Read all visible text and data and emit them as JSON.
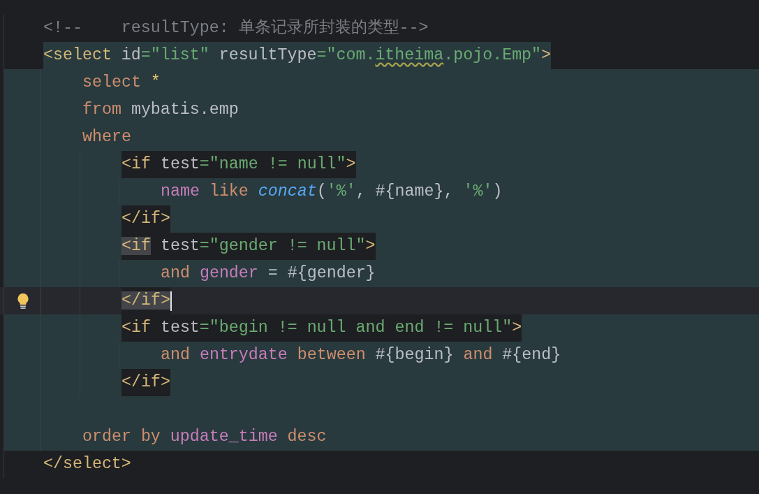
{
  "editor": {
    "lines": [
      {
        "highlighted": false,
        "current": false,
        "tokens": [
          {
            "kind": "comment",
            "text": "<!--    resultType: 单条记录所封装的类型-->"
          }
        ]
      },
      {
        "highlighted": false,
        "boxed": true,
        "current": false,
        "tokens": [
          {
            "kind": "tag",
            "text": "<select"
          },
          {
            "kind": "attr",
            "text": " id"
          },
          {
            "kind": "string",
            "text": "=\"list\""
          },
          {
            "kind": "attr",
            "text": " resultType"
          },
          {
            "kind": "string",
            "text": "=\"com."
          },
          {
            "kind": "string",
            "text": "itheima",
            "warning": true
          },
          {
            "kind": "string",
            "text": ".pojo.Emp\""
          },
          {
            "kind": "tag",
            "text": ">"
          }
        ],
        "children": [
          {
            "highlighted": true,
            "current": false,
            "tokens": [
              {
                "kind": "keyword",
                "text": "select"
              },
              {
                "kind": "operator",
                "text": " *"
              }
            ]
          },
          {
            "highlighted": true,
            "current": false,
            "tokens": [
              {
                "kind": "keyword",
                "text": "from"
              },
              {
                "kind": "plain",
                "text": " mybatis.emp"
              }
            ]
          },
          {
            "highlighted": true,
            "current": false,
            "tokens": [
              {
                "kind": "keyword",
                "text": "where"
              }
            ],
            "children": [
              {
                "highlighted": true,
                "boxed": true,
                "current": false,
                "tokens": [
                  {
                    "kind": "tag",
                    "text": "<if"
                  },
                  {
                    "kind": "attr",
                    "text": " test"
                  },
                  {
                    "kind": "string",
                    "text": "=\"name != null\""
                  },
                  {
                    "kind": "tag",
                    "text": ">"
                  }
                ],
                "children": [
                  {
                    "highlighted": true,
                    "current": false,
                    "tokens": [
                      {
                        "kind": "column",
                        "text": "name"
                      },
                      {
                        "kind": "keyword",
                        "text": " like"
                      },
                      {
                        "kind": "function",
                        "text": " concat"
                      },
                      {
                        "kind": "plain",
                        "text": "("
                      },
                      {
                        "kind": "string",
                        "text": "'%'"
                      },
                      {
                        "kind": "plain",
                        "text": ", #{name}, "
                      },
                      {
                        "kind": "string",
                        "text": "'%'"
                      },
                      {
                        "kind": "plain",
                        "text": ")"
                      }
                    ]
                  }
                ]
              },
              {
                "highlighted": true,
                "boxed": true,
                "current": false,
                "tokens": [
                  {
                    "kind": "tag",
                    "text": "</if>"
                  }
                ]
              },
              {
                "highlighted": true,
                "boxed": true,
                "current": false,
                "tokens": [
                  {
                    "kind": "tag",
                    "text": "<if",
                    "matched": true
                  },
                  {
                    "kind": "attr",
                    "text": " test"
                  },
                  {
                    "kind": "string",
                    "text": "=\"gender != null\""
                  },
                  {
                    "kind": "tag",
                    "text": ">"
                  }
                ],
                "children": [
                  {
                    "highlighted": true,
                    "current": false,
                    "tokens": [
                      {
                        "kind": "keyword",
                        "text": "and"
                      },
                      {
                        "kind": "column",
                        "text": " gender"
                      },
                      {
                        "kind": "plain",
                        "text": " = #{gender}"
                      }
                    ]
                  }
                ]
              },
              {
                "highlighted": true,
                "boxed": true,
                "current": true,
                "bulb": true,
                "tokens": [
                  {
                    "kind": "tag",
                    "text": "</if>",
                    "matched": true
                  }
                ]
              },
              {
                "highlighted": true,
                "boxed": true,
                "current": false,
                "tokens": [
                  {
                    "kind": "tag",
                    "text": "<if"
                  },
                  {
                    "kind": "attr",
                    "text": " test"
                  },
                  {
                    "kind": "string",
                    "text": "=\"begin != null and end != null\""
                  },
                  {
                    "kind": "tag",
                    "text": ">"
                  }
                ],
                "children": [
                  {
                    "highlighted": true,
                    "current": false,
                    "tokens": [
                      {
                        "kind": "keyword",
                        "text": "and"
                      },
                      {
                        "kind": "column",
                        "text": " entrydate"
                      },
                      {
                        "kind": "keyword",
                        "text": " between"
                      },
                      {
                        "kind": "plain",
                        "text": " #{begin} "
                      },
                      {
                        "kind": "keyword",
                        "text": "and"
                      },
                      {
                        "kind": "plain",
                        "text": " #{end}"
                      }
                    ]
                  }
                ]
              },
              {
                "highlighted": true,
                "boxed": true,
                "current": false,
                "tokens": [
                  {
                    "kind": "tag",
                    "text": "</if>"
                  }
                ]
              }
            ]
          },
          {
            "highlighted": true,
            "current": false
          },
          {
            "highlighted": true,
            "current": false,
            "tokens": [
              {
                "kind": "keyword",
                "text": "order by"
              },
              {
                "kind": "column",
                "text": " update_time"
              },
              {
                "kind": "keyword",
                "text": " desc"
              }
            ]
          }
        ]
      },
      {
        "highlighted": false,
        "current": false,
        "tokens": [
          {
            "kind": "tag",
            "text": "</select>"
          }
        ]
      }
    ]
  }
}
